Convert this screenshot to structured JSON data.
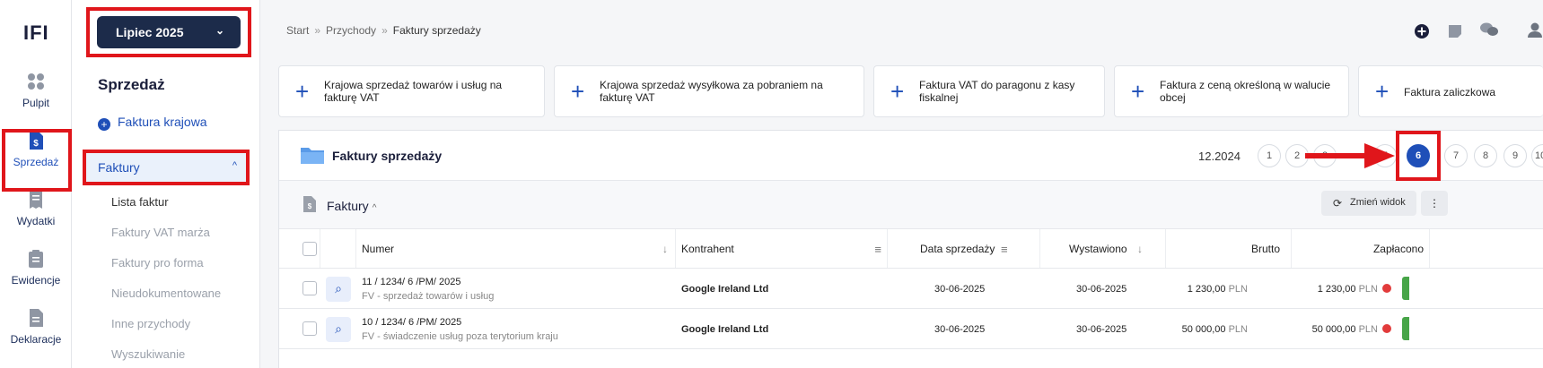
{
  "app": {
    "logo_text": "IFI"
  },
  "rail": {
    "items": [
      {
        "label": "Pulpit",
        "icon": "dashboard-icon"
      },
      {
        "label": "Sprzedaż",
        "icon": "invoice-dollar-icon"
      },
      {
        "label": "Wydatki",
        "icon": "receipt-icon"
      },
      {
        "label": "Ewidencje",
        "icon": "clipboard-list-icon"
      },
      {
        "label": "Deklaracje",
        "icon": "document-icon"
      }
    ]
  },
  "panel": {
    "month": "Lipiec 2025",
    "title": "Sprzedaż",
    "new_invoice": "Faktura krajowa",
    "section": "Faktury",
    "subitems": [
      "Lista faktur",
      "Faktury VAT marża",
      "Faktury pro forma",
      "Nieudokumentowane",
      "Inne przychody",
      "Wyszukiwanie"
    ]
  },
  "breadcrumb": {
    "items": [
      "Start",
      "Przychody",
      "Faktury sprzedaży"
    ]
  },
  "quick_actions": [
    "Krajowa sprzedaż towarów i usług na fakturę VAT",
    "Krajowa sprzedaż wysyłkowa za pobraniem na fakturę VAT",
    "Faktura VAT do paragonu z kasy fiskalnej",
    "Faktura z ceną określoną w walucie obcej",
    "Faktura zaliczkowa"
  ],
  "invoices": {
    "title": "Faktury sprzedaży",
    "period": "12.2024",
    "pages": [
      "1",
      "2",
      "3",
      "5",
      "6",
      "7",
      "8",
      "9",
      "10"
    ],
    "active_page": "6",
    "sub_title": "Faktury",
    "change_view": "Zmień widok",
    "columns": {
      "numer": "Numer",
      "kontrahent": "Kontrahent",
      "data": "Data sprzedaży",
      "wystawiono": "Wystawiono",
      "brutto": "Brutto",
      "zaplacono": "Zapłacono"
    },
    "rows": [
      {
        "numer": "11 / 1234/ 6 /PM/ 2025",
        "typ": "FV - sprzedaż towarów i usług",
        "kontrahent": "Google Ireland Ltd",
        "data": "30-06-2025",
        "wystawiono": "30-06-2025",
        "brutto": "1 230,00",
        "zaplacono": "1 230,00",
        "waluta": "PLN"
      },
      {
        "numer": "10 / 1234/ 6 /PM/ 2025",
        "typ": "FV - świadczenie usług poza terytorium kraju",
        "kontrahent": "Google Ireland Ltd",
        "data": "30-06-2025",
        "wystawiono": "30-06-2025",
        "brutto": "50 000,00",
        "zaplacono": "50 000,00",
        "waluta": "PLN"
      }
    ]
  },
  "colors": {
    "highlight": "#e0161b",
    "accent": "#1f4fb8",
    "dark_button": "#1c2b4a"
  }
}
